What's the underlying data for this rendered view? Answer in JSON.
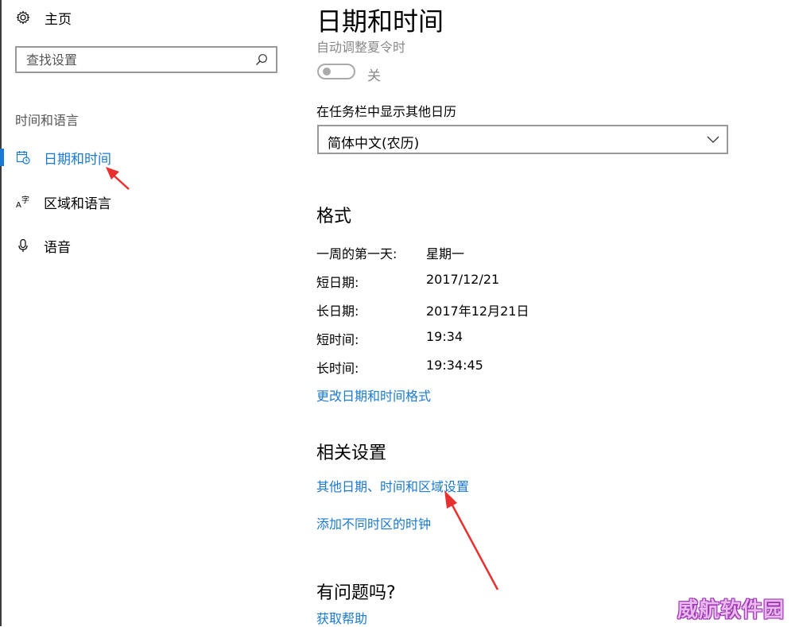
{
  "sidebar": {
    "home_label": "主页",
    "search_placeholder": "查找设置",
    "section_title": "时间和语言",
    "items": [
      {
        "label": "日期和时间",
        "icon": "calendar-clock-icon",
        "active": true
      },
      {
        "label": "区域和语言",
        "icon": "language-icon",
        "active": false
      },
      {
        "label": "语音",
        "icon": "microphone-icon",
        "active": false
      }
    ]
  },
  "main": {
    "title": "日期和时间",
    "dst_label": "自动调整夏令时",
    "dst_state": "关",
    "calendar_label": "在任务栏中显示其他日历",
    "calendar_value": "简体中文(农历)",
    "format_heading": "格式",
    "formats": [
      {
        "key": "一周的第一天:",
        "value": "星期一"
      },
      {
        "key": "短日期:",
        "value": "2017/12/21"
      },
      {
        "key": "长日期:",
        "value": "2017年12月21日"
      },
      {
        "key": "短时间:",
        "value": "19:34"
      },
      {
        "key": "长时间:",
        "value": "19:34:45"
      }
    ],
    "change_format_link": "更改日期和时间格式",
    "related_heading": "相关设置",
    "related_links": [
      "其他日期、时间和区域设置",
      "添加不同时区的时钟"
    ],
    "help_heading": "有问题吗?",
    "help_link": "获取帮助"
  },
  "watermark": "威航软件园",
  "colors": {
    "accent": "#1a79d2",
    "annotation_arrow": "#e8312f"
  }
}
